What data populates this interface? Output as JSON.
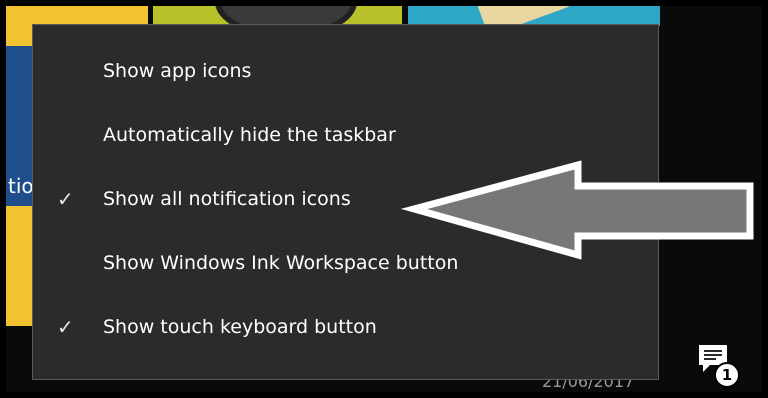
{
  "background": {
    "tile_label": "tio"
  },
  "context_menu": {
    "items": [
      {
        "label": "Show app icons",
        "checked": false
      },
      {
        "label": "Automatically hide the taskbar",
        "checked": false
      },
      {
        "label": "Show all notification icons",
        "checked": true
      },
      {
        "label": "Show Windows Ink Workspace button",
        "checked": false
      },
      {
        "label": "Show touch keyboard button",
        "checked": true
      }
    ],
    "check_glyph": "✓"
  },
  "taskbar": {
    "clock_partial": "21/06/2017",
    "notification_count": "1"
  },
  "colors": {
    "menu_background": "#2b2b2b",
    "menu_text": "#ffffff",
    "arrow_fill": "#777777",
    "arrow_outline": "#ffffff"
  }
}
